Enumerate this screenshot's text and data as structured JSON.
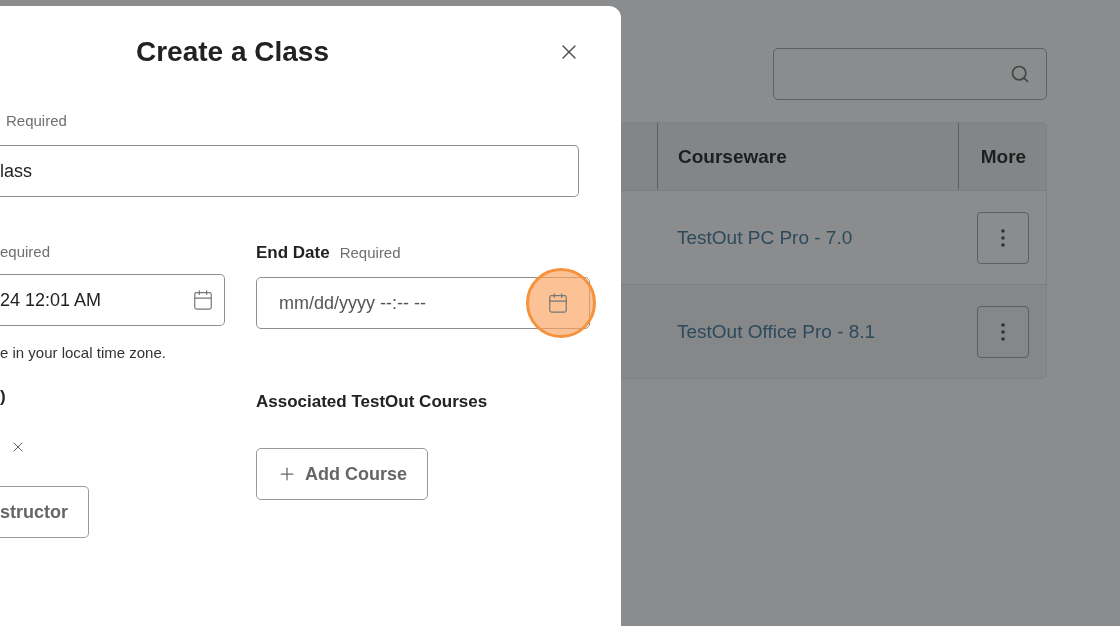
{
  "dialog": {
    "title": "Create a Class",
    "name_field": {
      "required": "Required",
      "value": "lass"
    },
    "start_date": {
      "required": "equired",
      "value": "24 12:01 AM"
    },
    "end_date": {
      "label": "End Date",
      "required": "Required",
      "placeholder": "mm/dd/yyyy --:-- --",
      "picker_highlighted": true
    },
    "timezone_hint": "e in your local time zone.",
    "instructors": {
      "label": ")",
      "button": "structor"
    },
    "courses": {
      "label": "Associated TestOut Courses",
      "button": "Add Course"
    }
  },
  "table": {
    "columns": [
      "Courseware",
      "More"
    ],
    "rows": [
      {
        "courseware": "TestOut PC Pro - 7.0"
      },
      {
        "courseware": "TestOut Office Pro - 8.1"
      }
    ]
  }
}
